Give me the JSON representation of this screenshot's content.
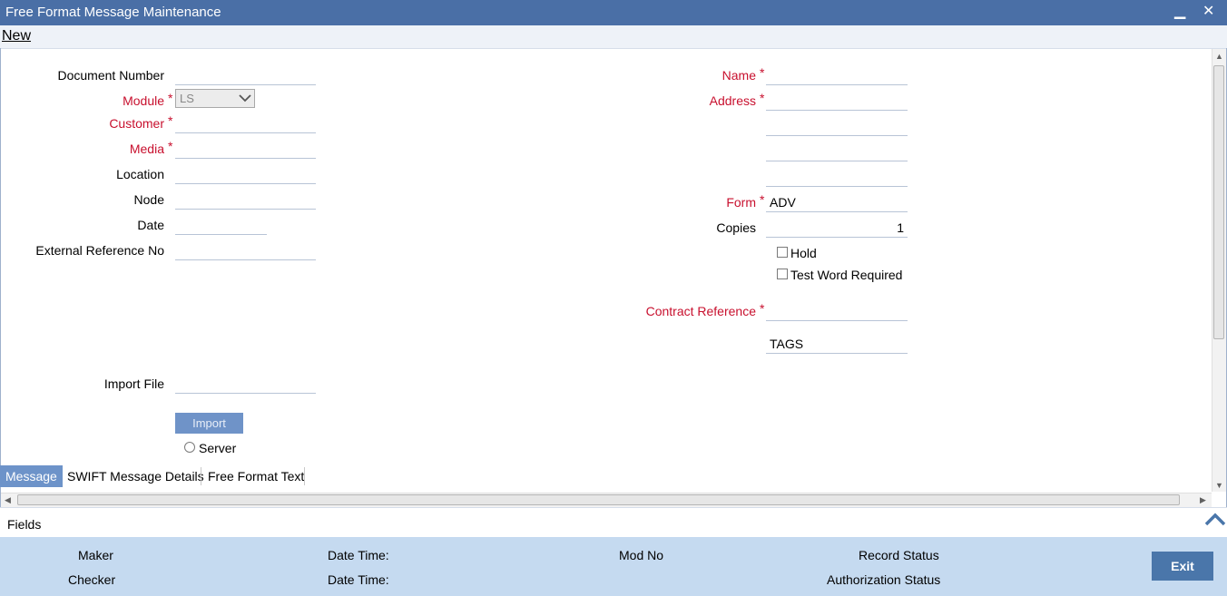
{
  "window": {
    "title": "Free Format Message Maintenance",
    "minimize_glyph": "▁",
    "close_glyph": "✕"
  },
  "toolbar": {
    "new_label": "New"
  },
  "left_form": {
    "document_number": {
      "label": "Document Number",
      "value": ""
    },
    "module": {
      "label": "Module",
      "value": "LS",
      "required": true
    },
    "customer": {
      "label": "Customer",
      "value": "",
      "required": true
    },
    "media": {
      "label": "Media",
      "value": "",
      "required": true
    },
    "location": {
      "label": "Location",
      "value": ""
    },
    "node": {
      "label": "Node",
      "value": ""
    },
    "date": {
      "label": "Date",
      "value": ""
    },
    "external_ref": {
      "label": "External Reference No",
      "value": ""
    },
    "import_file": {
      "label": "Import File",
      "value": ""
    },
    "import_button": "Import",
    "server_label": "Server"
  },
  "right_form": {
    "name": {
      "label": "Name",
      "value": "",
      "required": true
    },
    "address": {
      "label": "Address",
      "lines": [
        "",
        "",
        "",
        ""
      ],
      "required": true
    },
    "form": {
      "label": "Form",
      "value": "ADV",
      "required": true
    },
    "copies": {
      "label": "Copies",
      "value": "1"
    },
    "hold_label": "Hold",
    "test_word_label": "Test Word Required",
    "contract_reference": {
      "label": "Contract Reference",
      "value": "",
      "required": true
    },
    "tags_label": "TAGS"
  },
  "required_mark": "*",
  "tabs": [
    {
      "label": "Message",
      "active": true
    },
    {
      "label": "SWIFT Message Details",
      "active": false
    },
    {
      "label": "Free Format Text",
      "active": false
    }
  ],
  "fields_bar": {
    "label": "Fields"
  },
  "footer": {
    "maker": "Maker",
    "checker": "Checker",
    "date_time_1": "Date Time:",
    "date_time_2": "Date Time:",
    "mod_no": "Mod No",
    "record_status": "Record Status",
    "authorization_status": "Authorization Status",
    "exit_label": "Exit"
  },
  "colors": {
    "titlebar": "#4a6fa6",
    "required": "#c8102e",
    "active_tab": "#6d93c9",
    "footer": "#c5daf0",
    "exit_button": "#4a76aa"
  }
}
